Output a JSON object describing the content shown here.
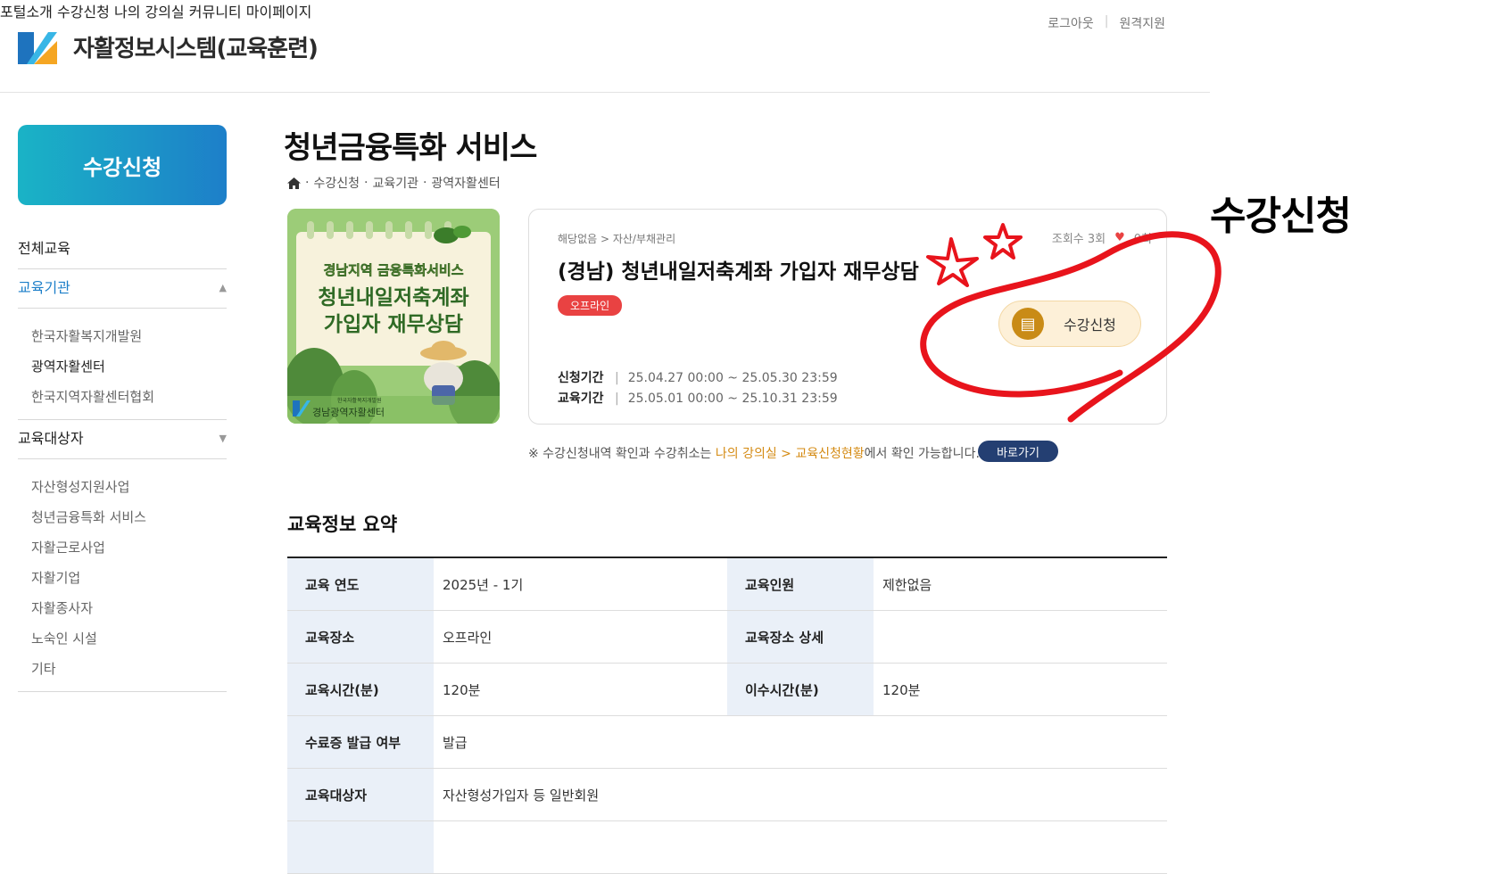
{
  "header": {
    "brand": "자활정보시스템(교육훈련)",
    "util": [
      "로그아웃",
      "원격지원"
    ],
    "nav": [
      "포털소개",
      "수강신청",
      "나의 강의실",
      "커뮤니티",
      "마이페이지"
    ]
  },
  "sidebar": {
    "title": "수강신청",
    "item_all": "전체교육",
    "item_org": "교육기관",
    "org_subs": [
      "한국자활복지개발원",
      "광역자활센터",
      "한국지역자활센터협회"
    ],
    "item_target": "교육대상자",
    "target_subs": [
      "자산형성지원사업",
      "청년금융특화 서비스",
      "자활근로사업",
      "자활기업",
      "자활종사자",
      "노숙인 시설",
      "기타"
    ]
  },
  "page": {
    "title": "청년금융특화 서비스",
    "breadcrumb": [
      "수강신청",
      "교육기관",
      "광역자활센터"
    ]
  },
  "thumbnail": {
    "line1": "경남지역 금융특화서비스",
    "line2": "청년내일저축계좌",
    "line3": "가입자 재무상담",
    "org": "경남광역자활센터",
    "org_small": "한국자활복지개발원"
  },
  "course": {
    "category": "해당없음 > 자산/부채관리",
    "title": "(경남) 청년내일저축계좌 가입자 재무상담",
    "tag": "오프라인",
    "views": "조회수 3회",
    "likes": "0회",
    "apply_label": "신청기간",
    "apply_period": "25.04.27 00:00 ~ 25.05.30 23:59",
    "edu_label": "교육기간",
    "edu_period": "25.05.01 00:00 ~ 25.10.31 23:59",
    "apply_button": "수강신청"
  },
  "notice": {
    "prefix": "※ 수강신청내역 확인과 수강취소는 ",
    "highlight": "나의 강의실 > 교육신청현황",
    "suffix": "에서 확인 가능합니다.",
    "go_button": "바로가기"
  },
  "summary": {
    "title": "교육정보 요약",
    "rows": [
      {
        "k1": "교육 연도",
        "v1": "2025년 - 1기",
        "k2": "교육인원",
        "v2": "제한없음"
      },
      {
        "k1": "교육장소",
        "v1": "오프라인",
        "k2": "교육장소 상세",
        "v2": ""
      },
      {
        "k1": "교육시간(분)",
        "v1": "120분",
        "k2": "이수시간(분)",
        "v2": "120분"
      },
      {
        "k1": "수료증 발급 여부",
        "v1": "발급"
      },
      {
        "k1": "교육대상자",
        "v1": "자산형성가입자 등 일반회원"
      }
    ]
  },
  "annotation": {
    "label": "수강신청",
    "color": "#e8141c"
  }
}
